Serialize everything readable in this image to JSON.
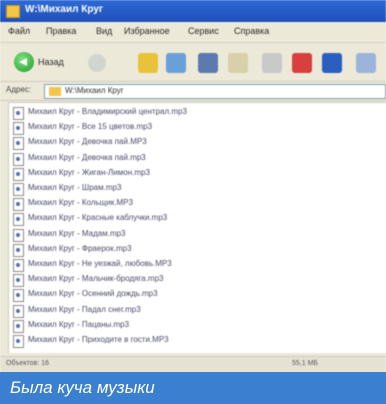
{
  "window": {
    "title": "W:\\Михаил Круг"
  },
  "menu": {
    "items": [
      {
        "label": "Файл"
      },
      {
        "label": "Правка"
      },
      {
        "label": "Вид"
      },
      {
        "label": "Избранное"
      },
      {
        "label": "Сервис"
      },
      {
        "label": "Справка"
      }
    ]
  },
  "toolbar": {
    "back_label": "Назад",
    "icons": [
      {
        "name": "up-folder-icon",
        "color": "#e8c33a"
      },
      {
        "name": "search-icon",
        "color": "#6aa0d8"
      },
      {
        "name": "cut-icon",
        "color": "#5c79b0"
      },
      {
        "name": "copy-icon",
        "color": "#d8d0a8"
      },
      {
        "name": "paste-icon",
        "color": "#c9c9c9"
      },
      {
        "name": "delete-icon",
        "color": "#d84040"
      },
      {
        "name": "undo-icon",
        "color": "#2a5fc0"
      },
      {
        "name": "views-icon",
        "color": "#9ab4da"
      }
    ]
  },
  "address": {
    "label": "Адрес:",
    "value": "W:\\Михаил Круг"
  },
  "files": [
    "Михаил Круг - Владимирский централ.mp3",
    "Михаил Круг - Все 15 цветов.mp3",
    "Михаил Круг - Девочка пай.MP3",
    "Михаил Круг - Девочка пай.mp3",
    "Михаил Круг - Жиган-Лимон.mp3",
    "Михаил Круг - Шрам.mp3",
    "Михаил Круг - Кольщик.MP3",
    "Михаил Круг - Красные каблучки.mp3",
    "Михаил Круг - Мадам.mp3",
    "Михаил Круг - Фраерок.mp3",
    "Михаил Круг - Не уезжай, любовь.MP3",
    "Михаил Круг - Мальчик-бродяга.mp3",
    "Михаил Круг - Осенний дождь.mp3",
    "Михаил Круг - Падал снег.mp3",
    "Михаил Круг - Пацаны.mp3",
    "Михаил Круг - Приходите в гости.MP3"
  ],
  "status": {
    "left": "Объектов: 16",
    "right": "55,1 МБ"
  },
  "caption": "Была куча музыки"
}
